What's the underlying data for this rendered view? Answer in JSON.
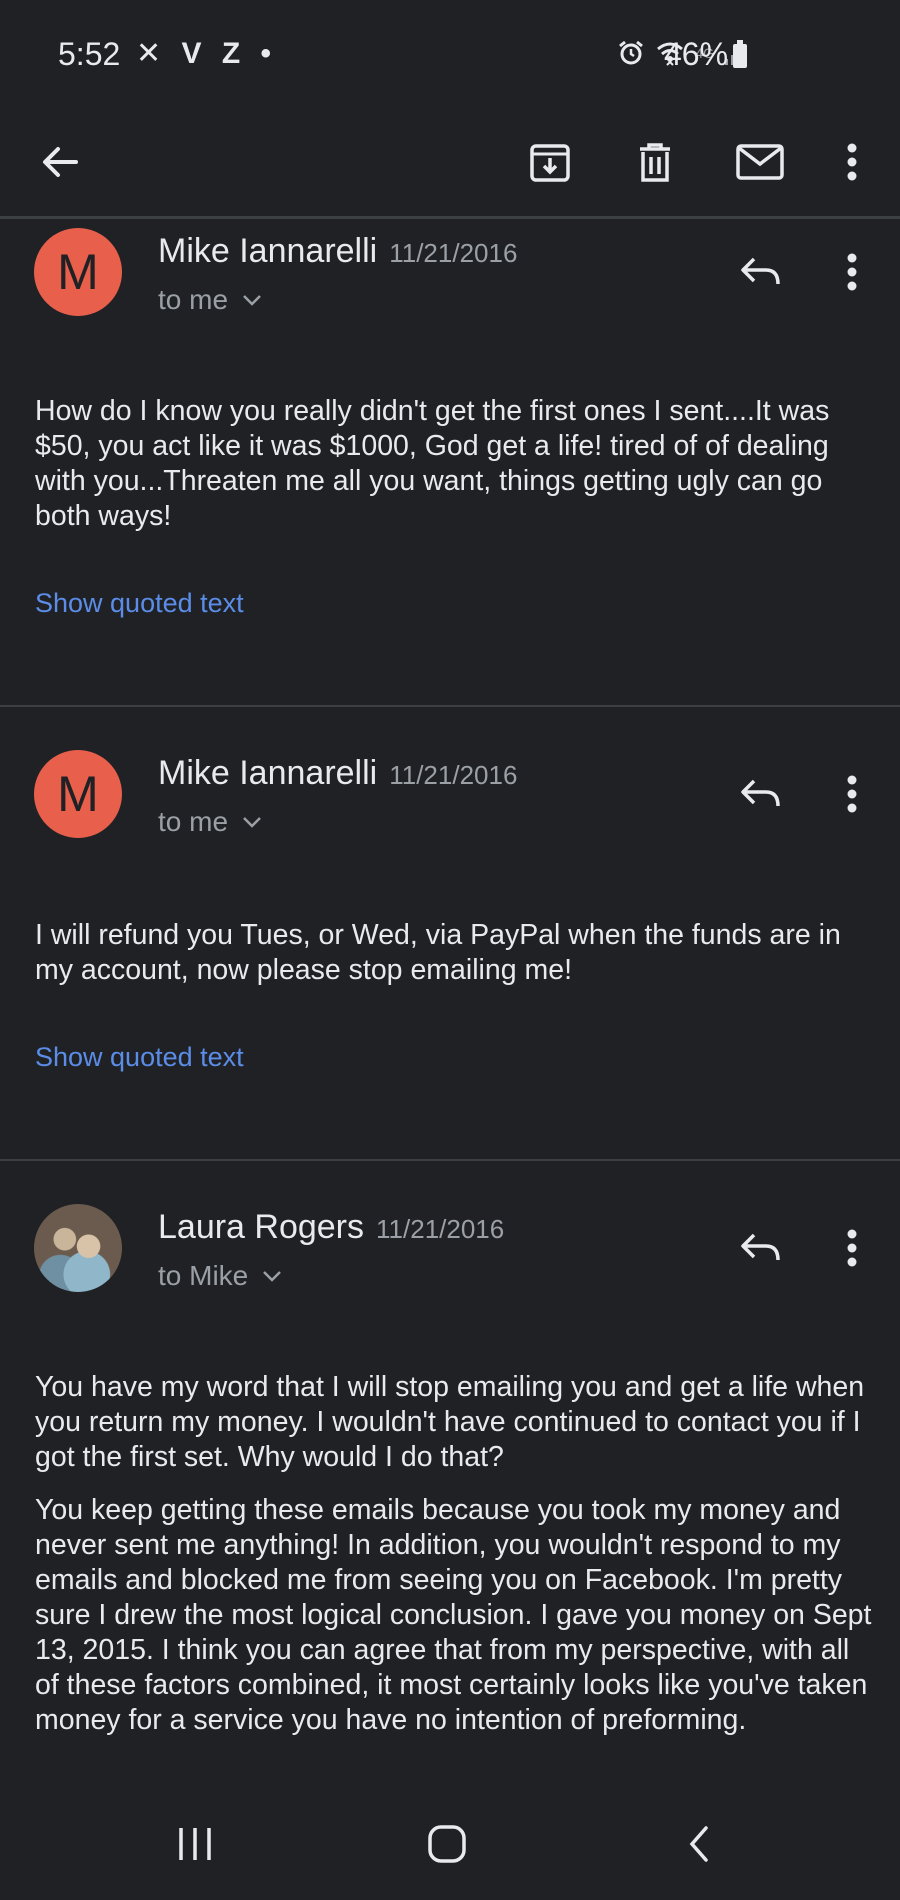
{
  "status_bar": {
    "time": "5:52",
    "left_icons": "✕ V Z •",
    "network": "4G",
    "battery": "46%"
  },
  "toolbar": {
    "back_icon": "arrow-left-icon",
    "archive_icon": "archive-icon",
    "delete_icon": "trash-icon",
    "mark_unread_icon": "mail-icon",
    "more_icon": "more-vert-icon"
  },
  "messages": [
    {
      "avatar_letter": "M",
      "sender": "Mike Iannarelli",
      "date": "11/21/2016",
      "recipient": "to me",
      "body": [
        "How do I know you really didn't get the first ones I sent....It was $50, you act like it was $1000, God get a life!  tired of of dealing with you...Threaten me all you want, things getting ugly can go both ways!"
      ],
      "show_quoted": "Show quoted text"
    },
    {
      "avatar_letter": "M",
      "sender": "Mike Iannarelli",
      "date": "11/21/2016",
      "recipient": "to me",
      "body": [
        "I will refund you Tues, or Wed, via PayPal when the funds are in my account, now please stop emailing me!"
      ],
      "show_quoted": "Show quoted text"
    },
    {
      "avatar_letter": "",
      "sender": "Laura Rogers",
      "date": "11/21/2016",
      "recipient": "to Mike",
      "body": [
        "You have my word that I will stop emailing you and get a life when you return my money. I wouldn't have continued to contact you if I got the first set. Why would I do that?",
        "You keep getting these emails because you took my money and never sent me anything! In addition, you wouldn't respond to my emails and blocked me from seeing you on Facebook. I'm pretty sure I drew the most logical conclusion. I gave you money on Sept 13, 2015. I think you can agree that from my perspective, with all of these factors combined, it most certainly looks like you've taken money for a service you have no intention of preforming."
      ],
      "show_quoted": ""
    }
  ],
  "colors": {
    "background": "#202124",
    "avatar": "#e8604c",
    "link": "#5b8de8",
    "secondary_text": "#9aa0a6"
  }
}
